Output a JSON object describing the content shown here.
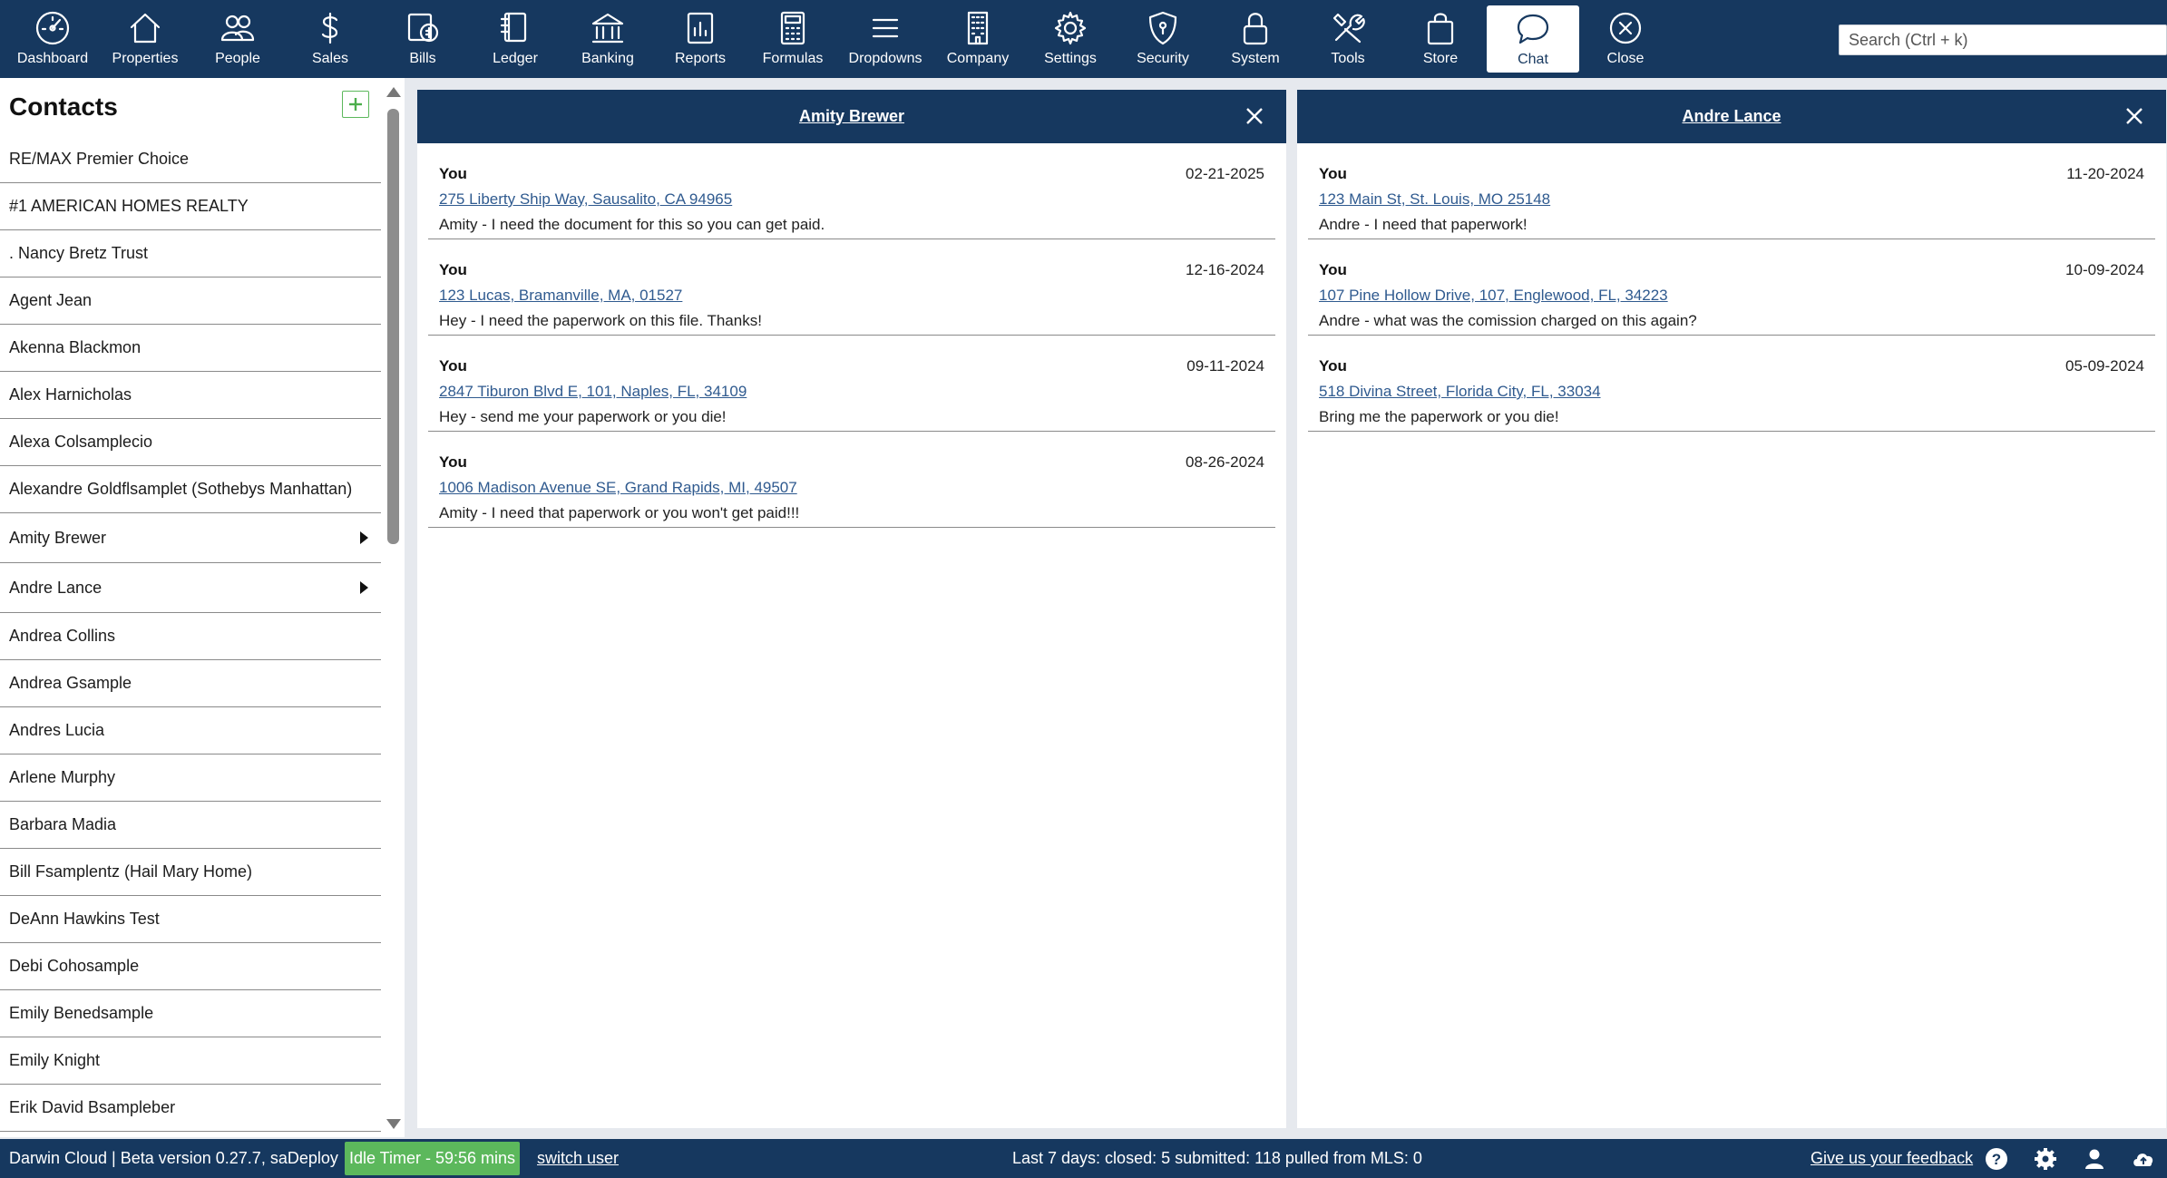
{
  "toolbar": {
    "items": [
      {
        "label": "Dashboard",
        "icon": "dashboard-icon"
      },
      {
        "label": "Properties",
        "icon": "house-icon"
      },
      {
        "label": "People",
        "icon": "people-icon"
      },
      {
        "label": "Sales",
        "icon": "dollar-icon"
      },
      {
        "label": "Bills",
        "icon": "bills-icon"
      },
      {
        "label": "Ledger",
        "icon": "ledger-icon"
      },
      {
        "label": "Banking",
        "icon": "bank-icon"
      },
      {
        "label": "Reports",
        "icon": "reports-icon"
      },
      {
        "label": "Formulas",
        "icon": "calculator-icon"
      },
      {
        "label": "Dropdowns",
        "icon": "menu-lines-icon"
      },
      {
        "label": "Company",
        "icon": "building-icon"
      },
      {
        "label": "Settings",
        "icon": "gear-icon"
      },
      {
        "label": "Security",
        "icon": "shield-icon"
      },
      {
        "label": "System",
        "icon": "lock-icon"
      },
      {
        "label": "Tools",
        "icon": "tools-icon"
      },
      {
        "label": "Store",
        "icon": "shopping-bag-icon"
      },
      {
        "label": "Chat",
        "icon": "chat-bubble-icon",
        "active": true
      },
      {
        "label": "Close",
        "icon": "close-circle-icon"
      }
    ],
    "search_placeholder": "Search (Ctrl + k)"
  },
  "sidebar": {
    "title": "Contacts",
    "add_icon": "plus-icon",
    "contacts": [
      {
        "name": "RE/MAX Premier Choice"
      },
      {
        "name": "#1 AMERICAN HOMES REALTY"
      },
      {
        "name": ". Nancy Bretz Trust"
      },
      {
        "name": "Agent Jean"
      },
      {
        "name": "Akenna Blackmon"
      },
      {
        "name": "Alex Harnicholas"
      },
      {
        "name": "Alexa Colsamplecio"
      },
      {
        "name": "Alexandre Goldflsamplet (Sothebys Manhattan)"
      },
      {
        "name": "Amity Brewer",
        "has_arrow": true
      },
      {
        "name": "Andre Lance",
        "has_arrow": true
      },
      {
        "name": "Andrea Collins"
      },
      {
        "name": "Andrea Gsample"
      },
      {
        "name": "Andres Lucia"
      },
      {
        "name": "Arlene Murphy"
      },
      {
        "name": "Barbara Madia"
      },
      {
        "name": "Bill Fsamplentz (Hail Mary Home)"
      },
      {
        "name": "DeAnn Hawkins Test"
      },
      {
        "name": "Debi Cohosample"
      },
      {
        "name": "Emily Benedsample"
      },
      {
        "name": "Emily Knight"
      },
      {
        "name": "Erik David Bsampleber"
      }
    ]
  },
  "panels": [
    {
      "title": "Amity Brewer",
      "messages": [
        {
          "sender": "You",
          "date": "02-21-2025",
          "link": "275 Liberty Ship Way, Sausalito, CA 94965",
          "text": "Amity - I need the document for this so you can get paid."
        },
        {
          "sender": "You",
          "date": "12-16-2024",
          "link": "123 Lucas, Bramanville, MA, 01527",
          "text": "Hey - I need the paperwork on this file. Thanks!"
        },
        {
          "sender": "You",
          "date": "09-11-2024",
          "link": "2847 Tiburon Blvd E, 101, Naples, FL, 34109",
          "text": "Hey - send me your paperwork or you die!"
        },
        {
          "sender": "You",
          "date": "08-26-2024",
          "link": "1006 Madison Avenue SE, Grand Rapids, MI, 49507",
          "text": "Amity - I need that paperwork or you won't get paid!!!"
        }
      ]
    },
    {
      "title": "Andre Lance",
      "messages": [
        {
          "sender": "You",
          "date": "11-20-2024",
          "link": "123 Main St, St. Louis, MO 25148",
          "text": "Andre - I need that paperwork!"
        },
        {
          "sender": "You",
          "date": "10-09-2024",
          "link": "107 Pine Hollow Drive, 107, Englewood, FL, 34223",
          "text": "Andre - what was the comission charged on this again?"
        },
        {
          "sender": "You",
          "date": "05-09-2024",
          "link": "518 Divina Street, Florida City, FL, 33034",
          "text": "Bring me the paperwork or you die!"
        }
      ]
    }
  ],
  "footer": {
    "version": "Darwin Cloud | Beta version 0.27.7, saDeploy",
    "idle_timer": "Idle Timer - 59:56 mins",
    "switch_user": "switch user",
    "stats": "Last 7 days: closed: 5 submitted: 118 pulled from MLS: 0",
    "feedback": "Give us your feedback",
    "icons": [
      "help-icon",
      "gear-icon",
      "user-icon",
      "cloud-upload-icon"
    ]
  },
  "colors": {
    "primary": "#16385f",
    "success": "#5cb85c",
    "link": "#2f5a8f"
  }
}
